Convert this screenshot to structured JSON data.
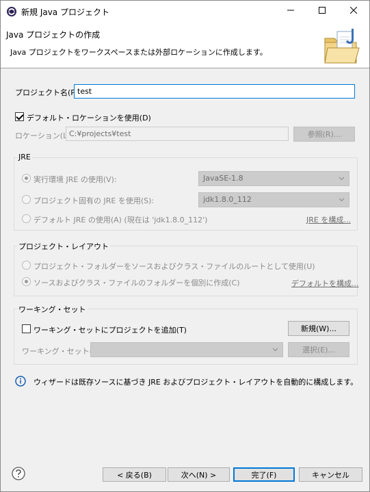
{
  "window": {
    "title": "新規 Java プロジェクト"
  },
  "banner": {
    "title": "Java プロジェクトの作成",
    "description": "Java プロジェクトをワークスペースまたは外部ロケーションに作成します。"
  },
  "project_name": {
    "label": "プロジェクト名(P):",
    "value": "test"
  },
  "location": {
    "use_default_label": "デフォルト・ロケーションを使用(D)",
    "use_default_checked": true,
    "label": "ロケーション(L):",
    "value": "C:¥projects¥test",
    "browse_label": "参照(R)..."
  },
  "jre": {
    "group_title": "JRE",
    "option_env_label": "実行環境 JRE の使用(V):",
    "option_env_value": "JavaSE-1.8",
    "option_project_label": "プロジェクト固有の JRE を使用(S):",
    "option_project_value": "jdk1.8.0_112",
    "option_default_label": "デフォルト JRE の使用(A) (現在は 'jdk1.8.0_112')",
    "configure_link": "JRE を構成..."
  },
  "layout": {
    "group_title": "プロジェクト・レイアウト",
    "option_root_label": "プロジェクト・フォルダーをソースおよびクラス・ファイルのルートとして使用(U)",
    "option_separate_label": "ソースおよびクラス・ファイルのフォルダーを個別に作成(C)",
    "configure_link": "デフォルトを構成..."
  },
  "working_set": {
    "group_title": "ワーキング・セット",
    "add_label": "ワーキング・セットにプロジェクトを追加(T)",
    "add_checked": false,
    "new_button": "新規(W)...",
    "sets_label": "ワーキング・セット(O):",
    "sets_value": "",
    "select_button": "選択(E)..."
  },
  "info": {
    "message": "ウィザードは既存ソースに基づき JRE およびプロジェクト・レイアウトを自動的に構成します。"
  },
  "footer": {
    "back": "< 戻る(B)",
    "next": "次へ(N) >",
    "finish": "完了(F)",
    "cancel": "キャンセル"
  },
  "colors": {
    "accent": "#0078d7",
    "info_icon": "#1a5fb4"
  }
}
